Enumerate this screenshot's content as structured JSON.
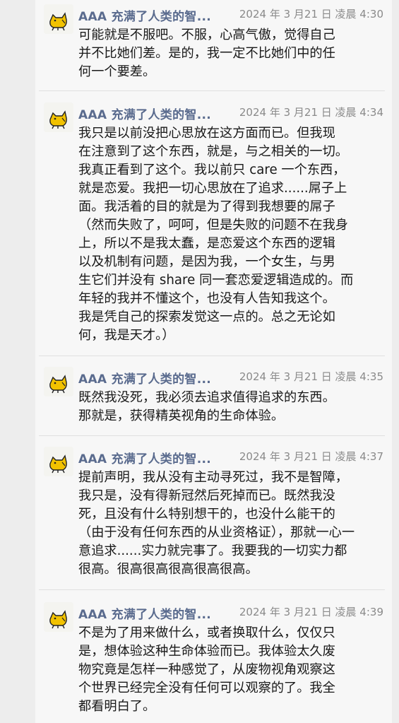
{
  "messages": [
    {
      "sender": "AAA 充满了人类的智...",
      "time": "2024 年 3 月21 日 凌晨 4:30",
      "text": "可能就是不服吧。不服，心高气傲，觉得自己\n并不比她们差。是的，我一定不比她们中的任\n何一个要差。"
    },
    {
      "sender": "AAA 充满了人类的智...",
      "time": "2024 年 3 月21 日 凌晨 4:34",
      "text": "我只是以前没把心思放在这方面而已。但我现\n在注意到了这个东西，就是，与之相关的一切。\n我真正看到了这个。我以前只 care 一个东西，\n就是恋爱。我把一切心思放在了追求......屌子上\n面。我活着的目的就是为了得到我想要的屌子\n（然而失败了，呵呵，但是失败的问题不在我身\n上，所以不是我太蠢，是恋爱这个东西的逻辑\n以及机制有问题，是因为我，一个女生，与男\n生它们并没有 share 同一套恋爱逻辑造成的。而\n年轻的我并不懂这个，也没有人告知我这个。\n我是凭自己的探索发觉这一点的。总之无论如\n何，我是天才。）"
    },
    {
      "sender": "AAA 充满了人类的智...",
      "time": "2024 年 3 月21 日 凌晨 4:35",
      "text": "既然我没死，我必须去追求值得追求的东西。\n那就是，获得精英视角的生命体验。"
    },
    {
      "sender": "AAA 充满了人类的智...",
      "time": "2024 年 3 月21 日 凌晨 4:37",
      "text": "提前声明，我从没有主动寻死过，我不是智障，\n我只是，没有得新冠然后死掉而已。既然我没\n死，且没有什么特别想干的，也没什么能干的\n（由于没有任何东西的从业资格证），那就一心一\n意追求......实力就完事了。我要我的一切实力都\n很高。很高很高很高很高很高。"
    },
    {
      "sender": "AAA 充满了人类的智...",
      "time": "2024 年 3 月21 日 凌晨 4:39",
      "text": "不是为了用来做什么，或者换取什么，仅仅只\n是，想体验这种生命体验而已。我体验太久废\n物究竟是怎样一种感觉了，从废物视角观察这\n个世界已经完全没有任何可以观察的了。我全\n都看明白了。"
    }
  ],
  "colors": {
    "sender": "#5a6b8e",
    "timestamp": "#8a8a8a",
    "text": "#191919",
    "avatar_cat": "#f2c200"
  },
  "icons": {
    "avatar": "yellow-cat-avatar-icon"
  }
}
